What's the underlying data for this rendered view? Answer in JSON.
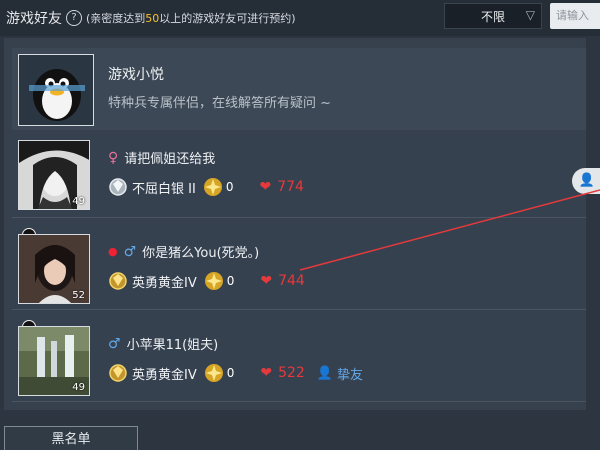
{
  "header": {
    "title": "游戏好友",
    "hint_prefix": "(亲密度达到",
    "hint_value": "50",
    "hint_suffix": "以上的游戏好友可进行预约)",
    "filter_selected": "不限",
    "search_placeholder": "请输入"
  },
  "official": {
    "name": "游戏小悦",
    "description": "特种兵专属伴侣，在线解答所有疑问 ~"
  },
  "friends": [
    {
      "name": "请把佩姐还给我",
      "gender": "♀",
      "level": "49",
      "rank": "不屈白银 II",
      "emblem_value": "0",
      "intimacy": "774"
    },
    {
      "name": "你是猪么You(死党。)",
      "gender": "♂",
      "level": "52",
      "rank": "英勇黄金IV",
      "emblem_value": "0",
      "intimacy": "744"
    },
    {
      "name": "小苹果11(姐夫)",
      "gender": "♂",
      "level": "49",
      "rank": "英勇黄金IV",
      "emblem_value": "0",
      "intimacy": "522",
      "relation": "挚友"
    }
  ],
  "footer": {
    "blacklist": "黑名单"
  },
  "colors": {
    "intimacy": "#e5393b",
    "highlight": "#f2c230",
    "male": "#62a8e8",
    "female": "#e6709a"
  },
  "icons": [
    "help-icon",
    "chevron-down-icon",
    "penguin-avatar-icon",
    "heart-icon",
    "rank-badge-icon",
    "emblem-icon",
    "person-icon",
    "add-friend-icon"
  ]
}
